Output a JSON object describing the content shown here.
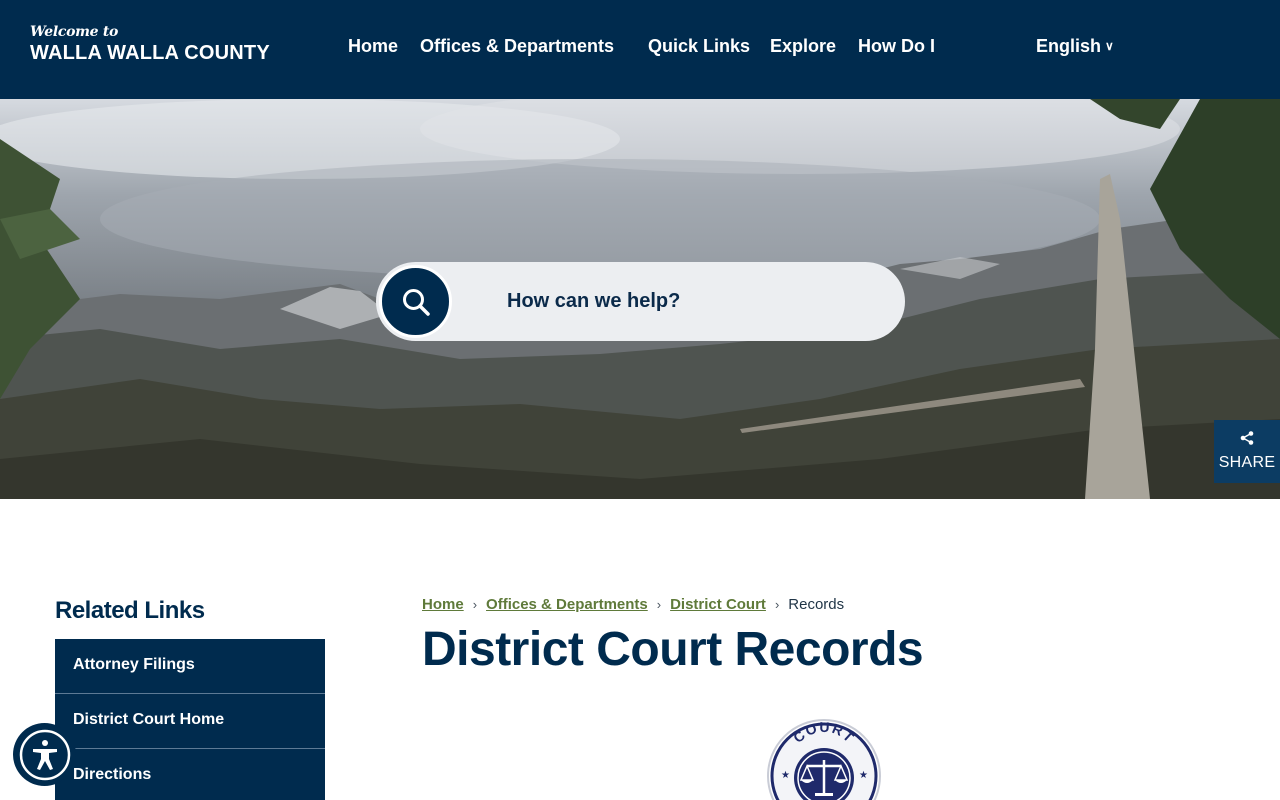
{
  "header": {
    "logo_welcome": "Welcome to",
    "logo_county": "WALLA WALLA COUNTY",
    "nav": [
      "Home",
      "Offices & Departments",
      "Quick Links",
      "Explore",
      "How Do I"
    ],
    "language": "English"
  },
  "hero": {
    "search_placeholder": "How can we help?",
    "share_label": "SHARE"
  },
  "sidebar": {
    "title": "Related Links",
    "items": [
      "Attorney Filings",
      "District Court Home",
      "Directions"
    ]
  },
  "breadcrumb": {
    "items": [
      "Home",
      "Offices & Departments",
      "District Court"
    ],
    "current": "Records"
  },
  "page": {
    "title": "District Court Records",
    "seal_text": "COURT"
  },
  "colors": {
    "primary": "#002b4e",
    "breadcrumb_link": "#5f7a3a"
  }
}
